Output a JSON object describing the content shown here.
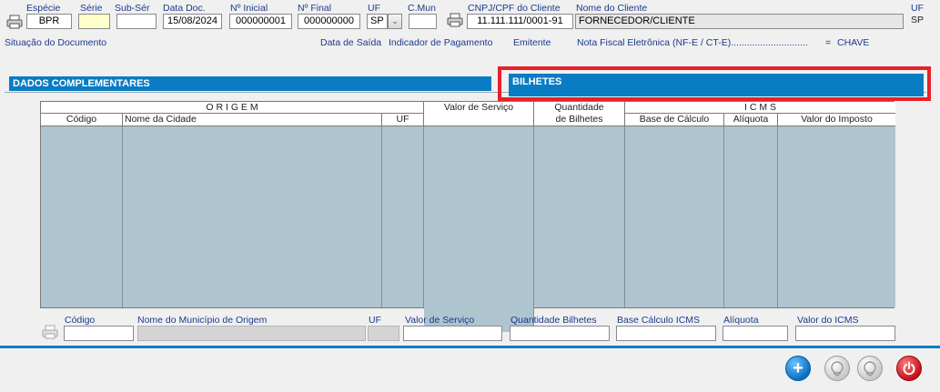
{
  "header": {
    "especie_label": "Espécie",
    "especie_value": "BPR",
    "serie_label": "Série",
    "serie_value": "",
    "subserie_label": "Sub-Sér",
    "subserie_value": "",
    "data_doc_label": "Data Doc.",
    "data_doc_value": "15/08/2024",
    "num_inicial_label": "Nº Inicial",
    "num_inicial_value": "000000001",
    "num_final_label": "Nº Final",
    "num_final_value": "000000000",
    "uf_label": "UF",
    "uf_value": "SP",
    "cmun_label": "C.Mun",
    "cmun_value": "",
    "cnpj_label": "CNPJ/CPF do Cliente",
    "cnpj_value": "11.111.111/0001-91",
    "nome_label": "Nome do Cliente",
    "nome_value": "FORNECEDOR/CLIENTE",
    "uf2_label": "UF",
    "uf2_value": "SP"
  },
  "info_row": {
    "situacao": "Situação do Documento",
    "data_saida": "Data de Saída",
    "indicador": "Indicador de Pagamento",
    "emitente": "Emitente",
    "nfe": "Nota Fiscal Eletrônica (NF-E / CT-E).............................",
    "eq": "=",
    "chave": "CHAVE"
  },
  "tabs": {
    "dados": "DADOS COMPLEMENTARES",
    "bilhetes": "BILHETES"
  },
  "grid": {
    "group_origem": "O R I G E M",
    "group_icms": "I C M S",
    "col_codigo": "Código",
    "col_cidade": "Nome da Cidade",
    "col_uf": "UF",
    "col_valor_servico": "Valor de Serviço",
    "col_qtd_1": "Quantidade",
    "col_qtd_2": "de Bilhetes",
    "col_base": "Base de Cálculo",
    "col_aliquota": "Alíquota",
    "col_valor_imposto": "Valor do Imposto"
  },
  "edit_row": {
    "codigo": "Código",
    "municipio": "Nome do Município de Origem",
    "uf": "UF",
    "valor_servico": "Valor de Serviço",
    "qtd_bilhetes": "Quantidade Bilhetes",
    "base_icms": "Base Cálculo ICMS",
    "aliquota": "Alíquota",
    "valor_icms": "Valor do ICMS"
  },
  "colors": {
    "tab_blue": "#0a7cc4",
    "highlight_red": "#e8202a",
    "grid_fill": "#aec4cf"
  },
  "icons": [
    "printer-icon",
    "add-icon",
    "disabled-round-icon",
    "power-icon"
  ]
}
